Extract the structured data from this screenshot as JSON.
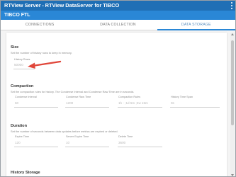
{
  "app": {
    "title": "RTView Server",
    "separator": "-",
    "subtitle": "RTView DataServer for TIBCO"
  },
  "page": {
    "title": "TIBCO FTL"
  },
  "tabs": [
    {
      "label": "CONNECTIONS",
      "active": false
    },
    {
      "label": "DATA COLLECTION",
      "active": false
    },
    {
      "label": "DATA STORAGE",
      "active": true
    }
  ],
  "size": {
    "title": "Size",
    "description": "Set the number of history rows to keep in memory.",
    "history_rows": {
      "label": "History Rows",
      "value": "50000"
    }
  },
  "compaction": {
    "title": "Compaction",
    "description": "Set the compaction rules for history. The Condense Interval and Condense Raw Time are in seconds.",
    "condense_interval": {
      "label": "Condense Interval",
      "value": "60"
    },
    "condense_raw_time": {
      "label": "Condense Raw Time",
      "value": "1200"
    },
    "compaction_rules": {
      "label": "Compaction Rules",
      "value": "1h - ;1d 5m ;2w 15m"
    },
    "history_time_span": {
      "label": "History Time Span",
      "value": "0s"
    }
  },
  "duration": {
    "title": "Duration",
    "description": "Set the number of seconds between data updates before metrics are expired or deleted.",
    "expire_time": {
      "label": "Expire Time",
      "value": "120"
    },
    "server_expire_time": {
      "label": "Server Expire Time",
      "value": "10"
    },
    "delete_time": {
      "label": "Delete Time",
      "value": "3600"
    }
  },
  "history_storage": {
    "title": "History Storage"
  },
  "colors": {
    "app_bar": "#1f6fb5",
    "title_bar": "#2a87d6",
    "arrow": "#e0463a"
  }
}
